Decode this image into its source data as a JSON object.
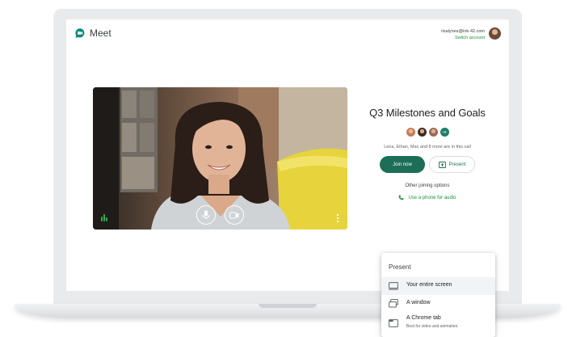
{
  "app": {
    "name": "Meet",
    "brand_color": "#00897b"
  },
  "account": {
    "email": "risalynes@ink-42.com",
    "switch_label": "Switch account"
  },
  "meeting": {
    "title": "Q3 Milestones and Goals",
    "participants": [
      {
        "name": "Lena",
        "color": "#c77b5a"
      },
      {
        "name": "Ethan",
        "color": "#6b4b3e"
      },
      {
        "name": "Max",
        "color": "#9b6a58"
      }
    ],
    "more_badge": "+8",
    "in_call_text": "Lena, Ethan, Max and 8 more are in this call"
  },
  "actions": {
    "join_label": "Join now",
    "present_label": "Present",
    "other_options": "Other joining options",
    "phone_label": "Use a phone for audio"
  },
  "video_controls": {
    "icons": [
      "audio-level-icon",
      "microphone-icon",
      "camera-icon",
      "more-vert-icon"
    ]
  },
  "present_menu": {
    "title": "Present",
    "items": [
      {
        "label": "Your entire screen",
        "icon": "monitor-icon"
      },
      {
        "label": "A window",
        "icon": "window-icon"
      },
      {
        "label": "A Chrome tab",
        "sublabel": "Best for video and animation",
        "icon": "tab-icon"
      }
    ]
  },
  "colors": {
    "accent": "#1e6e57",
    "link": "#1e8e3e"
  }
}
